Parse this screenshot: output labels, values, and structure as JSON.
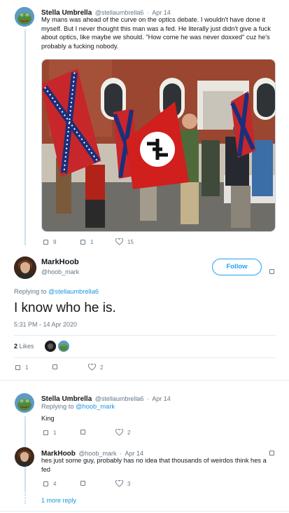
{
  "tweet1": {
    "name": "Stella Umbrella",
    "handle": "@stellaumbrella6",
    "sep": "·",
    "date": "Apr 14",
    "text": "My mans was ahead of the curve on the optics debate. I wouldn't have done it myself. But I never thought this man was a fed. He literally just didn't give a fuck about optics, like maybe we should. \"How come he was never doxxed\" cuz he's probably a fucking nobody.",
    "replies": "9",
    "retweets": "1",
    "likes": "15"
  },
  "main": {
    "name": "MarkHoob",
    "handle": "@hoob_mark",
    "follow_label": "Follow",
    "replying_prefix": "Replying to ",
    "replying_to": "@stellaumbrella6",
    "text": "I know who he is.",
    "timestamp": "5:31 PM - 14 Apr 2020",
    "likes_count": "2",
    "likes_label": "Likes",
    "replies": "1",
    "likes": "2"
  },
  "reply1": {
    "name": "Stella Umbrella",
    "handle": "@stellaumbrella6",
    "sep": "·",
    "date": "Apr 14",
    "replying_prefix": "Replying to ",
    "replying_to": "@hoob_mark",
    "text": "King",
    "replies": "1",
    "likes": "2"
  },
  "reply2": {
    "name": "MarkHoob",
    "handle": "@hoob_mark",
    "sep": "·",
    "date": "Apr 14",
    "text": "hes just some guy, probably has no idea that thousands of weirdos think hes a fed",
    "replies": "4",
    "likes": "3"
  },
  "more_replies": "1 more reply",
  "colors": {
    "accent": "#1da1f2",
    "link": "#1b95e0",
    "thread_line": "#c4e3f7",
    "muted": "#657786"
  }
}
